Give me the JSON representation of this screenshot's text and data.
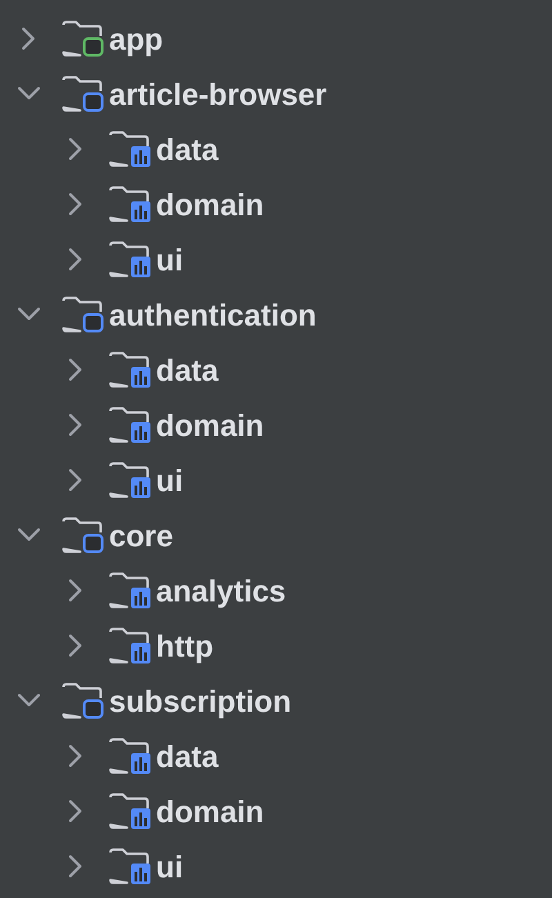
{
  "tree": [
    {
      "label": "app",
      "kind": "app-module",
      "expanded": false
    },
    {
      "label": "article-browser",
      "kind": "module",
      "expanded": true,
      "children": [
        {
          "label": "data",
          "kind": "package",
          "expanded": false
        },
        {
          "label": "domain",
          "kind": "package",
          "expanded": false
        },
        {
          "label": "ui",
          "kind": "package",
          "expanded": false
        }
      ]
    },
    {
      "label": "authentication",
      "kind": "module",
      "expanded": true,
      "children": [
        {
          "label": "data",
          "kind": "package",
          "expanded": false
        },
        {
          "label": "domain",
          "kind": "package",
          "expanded": false
        },
        {
          "label": "ui",
          "kind": "package",
          "expanded": false
        }
      ]
    },
    {
      "label": "core",
      "kind": "module",
      "expanded": true,
      "children": [
        {
          "label": "analytics",
          "kind": "package",
          "expanded": false
        },
        {
          "label": "http",
          "kind": "package",
          "expanded": false
        }
      ]
    },
    {
      "label": "subscription",
      "kind": "module",
      "expanded": true,
      "children": [
        {
          "label": "data",
          "kind": "package",
          "expanded": false
        },
        {
          "label": "domain",
          "kind": "package",
          "expanded": false
        },
        {
          "label": "ui",
          "kind": "package",
          "expanded": false
        }
      ]
    }
  ]
}
